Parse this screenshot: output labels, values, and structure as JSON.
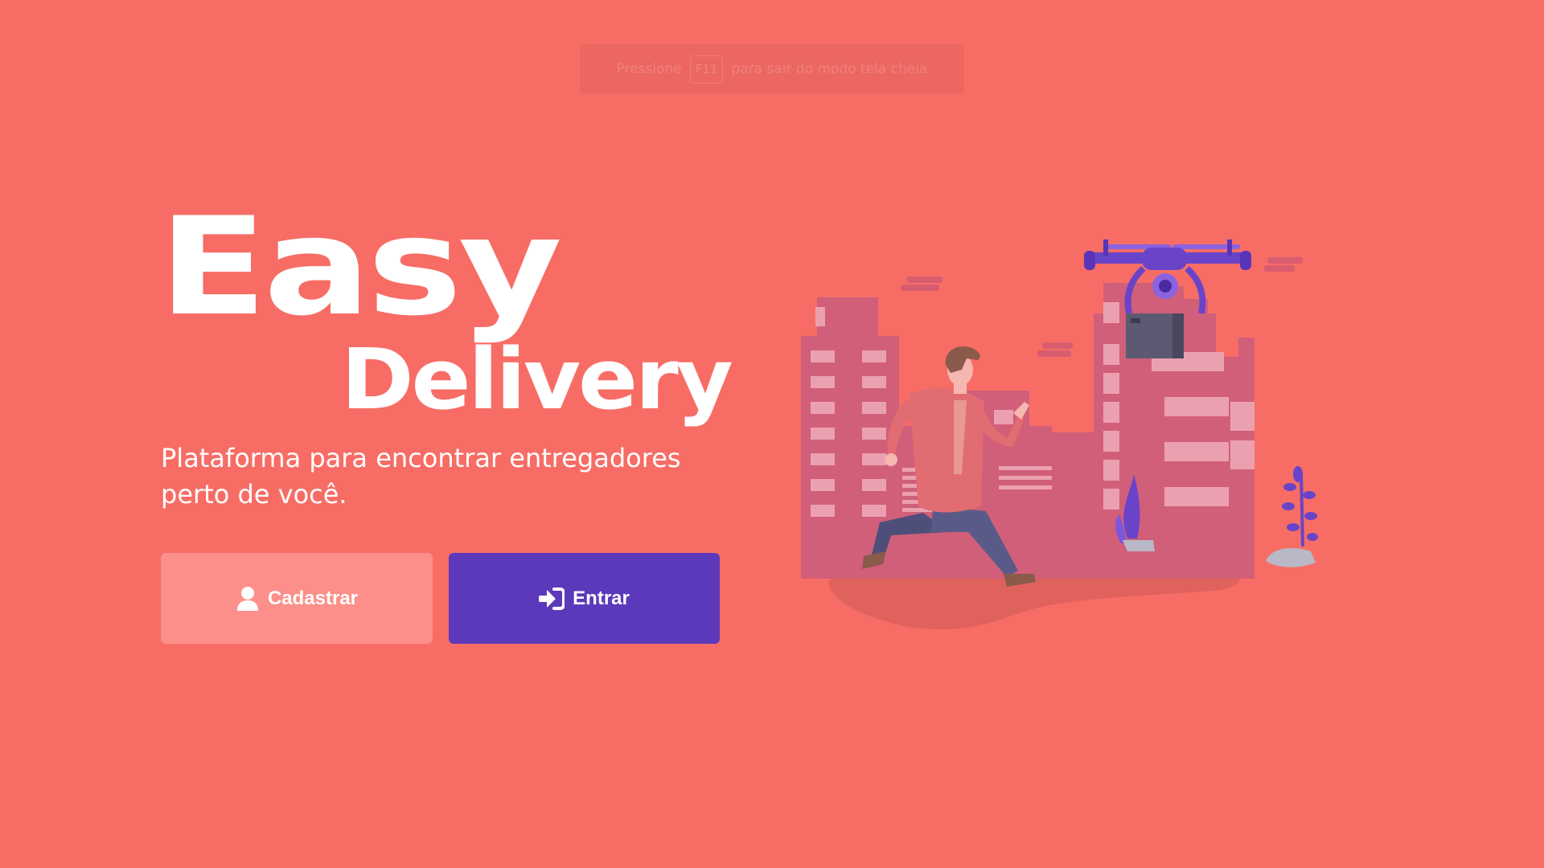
{
  "fullscreen_hint": {
    "prefix": "Pressione",
    "key": "F11",
    "suffix": "para sair do modo tela cheia"
  },
  "brand": {
    "line1": "Easy",
    "line2": "Delivery"
  },
  "tagline": "Plataforma para encontrar entregadores perto de você.",
  "buttons": {
    "register": {
      "label": "Cadastrar",
      "icon": "user-icon"
    },
    "login": {
      "label": "Entrar",
      "icon": "sign-in-icon"
    }
  },
  "illustration": {
    "name": "delivery-drone-city-illustration"
  },
  "colors": {
    "background": "#F76D66",
    "register_button": "#FC8F89",
    "login_button": "#5C39BA",
    "buildings": "#D15F79",
    "drone": "#6A44C8",
    "text": "#FFFFFF"
  }
}
